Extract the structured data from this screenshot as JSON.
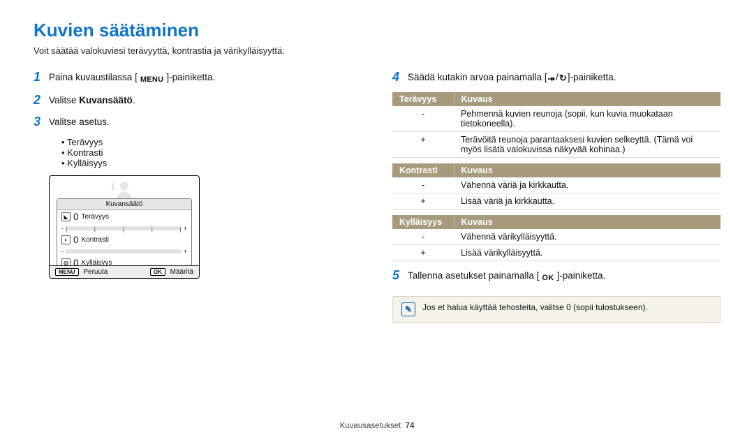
{
  "title": "Kuvien säätäminen",
  "intro": "Voit säätää valokuviesi terävyyttä, kontrastia ja värikylläisyyttä.",
  "steps_left": {
    "1": {
      "pre": "Paina kuvaustilassa [",
      "btn": "MENU",
      "post": "]-painiketta."
    },
    "2": {
      "pre": "Valitse ",
      "bold": "Kuvansäätö",
      "post": "."
    },
    "3": {
      "txt": "Valitse asetus."
    }
  },
  "bullets": [
    "Terävyys",
    "Kontrasti",
    "Kylläisyys"
  ],
  "screen": {
    "panel_title": "Kuvansäätö",
    "rows": [
      {
        "label": "Terävyys",
        "value": "0"
      },
      {
        "label": "Kontrasti",
        "value": "0"
      },
      {
        "label": "Kylläisyys",
        "value": "0"
      }
    ],
    "cancel_btn": "MENU",
    "cancel_label": "Peruuta",
    "ok_btn": "OK",
    "ok_label": "Määritä"
  },
  "steps_right": {
    "4": {
      "pre": "Säädä kutakin arvoa painamalla [",
      "g1": "⯭",
      "sep": "/",
      "g2": "⏲",
      "post": "]-painiketta."
    },
    "5": {
      "pre": "Tallenna asetukset painamalla [",
      "btn": "OK",
      "post": "]-painiketta."
    }
  },
  "tables": [
    {
      "headers": [
        "Terävyys",
        "Kuvaus"
      ],
      "rows": [
        {
          "c1": "-",
          "c2": "Pehmennä kuvien reunoja (sopii, kun kuvia muokataan tietokoneella)."
        },
        {
          "c1": "+",
          "c2": "Terävöitä reunoja parantaaksesi kuvien selkeyttä. (Tämä voi myös lisätä valokuvissa näkyvää kohinaa.)"
        }
      ]
    },
    {
      "headers": [
        "Kontrasti",
        "Kuvaus"
      ],
      "rows": [
        {
          "c1": "-",
          "c2": "Vähennä väriä ja kirkkautta."
        },
        {
          "c1": "+",
          "c2": "Lisää väriä ja kirkkautta."
        }
      ]
    },
    {
      "headers": [
        "Kylläisyys",
        "Kuvaus"
      ],
      "rows": [
        {
          "c1": "-",
          "c2": "Vähennä värikylläisyyttä."
        },
        {
          "c1": "+",
          "c2": "Lisää värikylläisyyttä."
        }
      ]
    }
  ],
  "note": "Jos et halua käyttää tehosteita, valitse 0 (sopii tulostukseen).",
  "footer": {
    "section": "Kuvausasetukset",
    "page": "74"
  }
}
